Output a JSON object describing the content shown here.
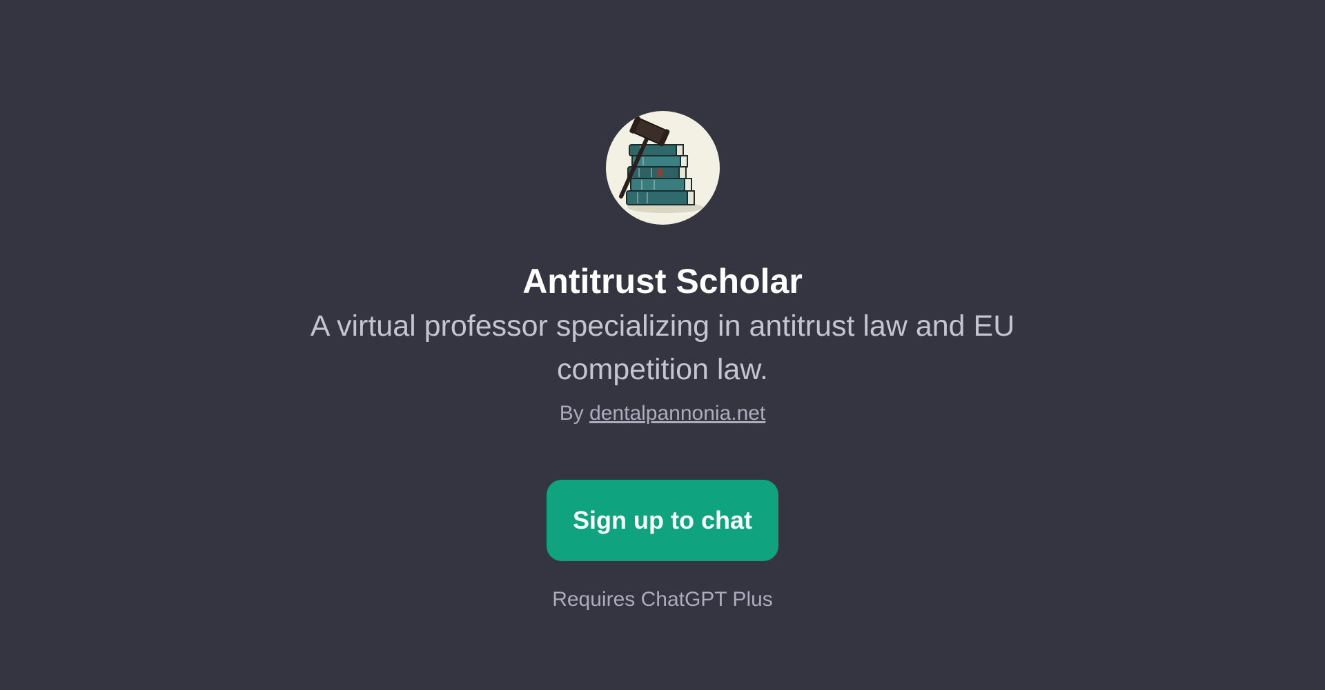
{
  "gpt": {
    "avatar_icon": "stacked-law-books-with-gavel",
    "title": "Antitrust Scholar",
    "description": "A virtual professor specializing in antitrust law and EU competition law.",
    "by_prefix": "By",
    "author_link": "dentalpannonia.net"
  },
  "cta": {
    "label": "Sign up to chat",
    "color": "#10a37f"
  },
  "footer": {
    "requires": "Requires ChatGPT Plus"
  },
  "theme": {
    "background": "#343541"
  }
}
